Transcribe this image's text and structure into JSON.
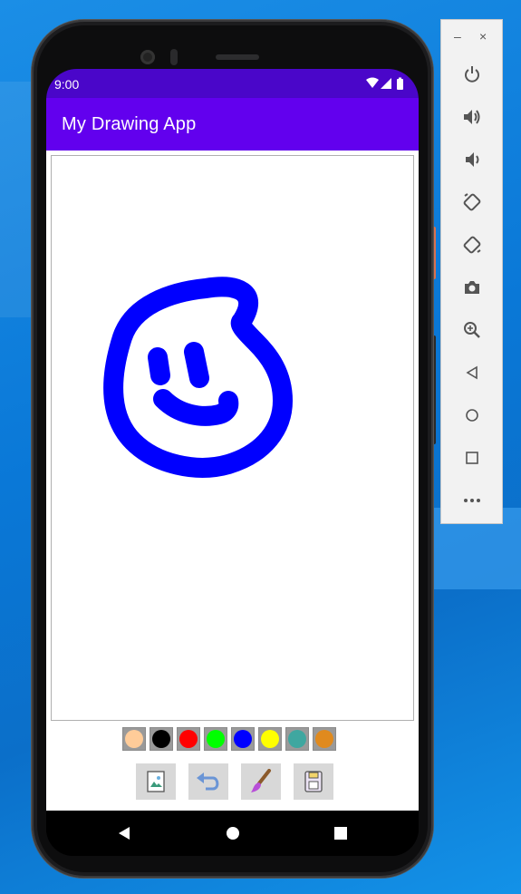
{
  "status_bar": {
    "time": "9:00"
  },
  "app_bar": {
    "title": "My Drawing App"
  },
  "palette": {
    "colors": [
      "#ffcc99",
      "#000000",
      "#ff0000",
      "#00ff00",
      "#0000ff",
      "#ffff00",
      "#3fa7a0",
      "#e08a1e"
    ],
    "selected_index": 4
  },
  "drawing": {
    "stroke_color": "#0000ff"
  },
  "toolbar": {
    "icons": [
      "gallery-icon",
      "undo-icon",
      "brush-icon",
      "save-icon"
    ]
  },
  "navigation": {
    "icons": [
      "back-icon",
      "home-icon",
      "recents-icon"
    ]
  },
  "emulator_panel": {
    "window_controls": {
      "minimize": "–",
      "close": "×"
    },
    "icons": [
      "power-icon",
      "volume-up-icon",
      "volume-down-icon",
      "rotate-left-icon",
      "rotate-right-icon",
      "camera-icon",
      "zoom-icon",
      "back-icon",
      "home-icon",
      "overview-icon",
      "more-icon"
    ]
  },
  "colors": {
    "status_bar": "#4a06c9",
    "app_bar": "#6200ee"
  }
}
